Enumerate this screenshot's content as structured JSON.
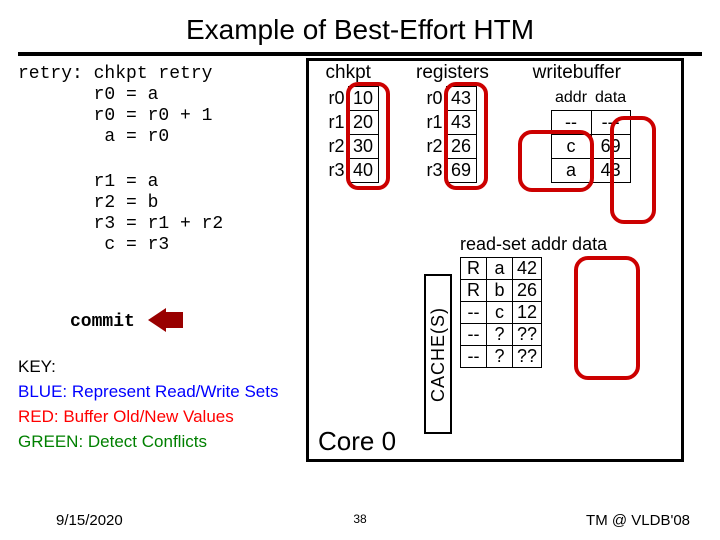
{
  "title": "Example of Best-Effort HTM",
  "code_block1": "retry: chkpt retry\n       r0 = a\n       r0 = r0 + 1\n        a = r0",
  "code_block2": "       r1 = a\n       r2 = b\n       r3 = r1 + r2\n        c = r3",
  "commit": "commit",
  "key": {
    "title": "KEY:",
    "blue": "BLUE: Represent Read/Write Sets",
    "red": "RED: Buffer Old/New Values",
    "green": "GREEN: Detect Conflicts"
  },
  "core_label": "Core 0",
  "cache_label": "CACHE(S)",
  "chkpt": {
    "header": "chkpt",
    "rows": [
      {
        "reg": "r0",
        "val": "10"
      },
      {
        "reg": "r1",
        "val": "20"
      },
      {
        "reg": "r2",
        "val": "30"
      },
      {
        "reg": "r3",
        "val": "40"
      }
    ]
  },
  "registers": {
    "header": "registers",
    "rows": [
      {
        "reg": "r0",
        "val": "43"
      },
      {
        "reg": "r1",
        "val": "43"
      },
      {
        "reg": "r2",
        "val": "26"
      },
      {
        "reg": "r3",
        "val": "69"
      }
    ]
  },
  "writebuffer": {
    "header": "writebuffer",
    "sub_addr": "addr",
    "sub_data": "data",
    "rows": [
      {
        "addr": "--",
        "data": "---"
      },
      {
        "addr": "c",
        "data": "69"
      },
      {
        "addr": "a",
        "data": "43"
      }
    ]
  },
  "readset": {
    "header": "read-set addr data",
    "rows": [
      {
        "flag": "R",
        "addr": "a",
        "data": "42"
      },
      {
        "flag": "R",
        "addr": "b",
        "data": "26"
      },
      {
        "flag": "--",
        "addr": "c",
        "data": "12"
      },
      {
        "flag": "--",
        "addr": "?",
        "data": "??"
      },
      {
        "flag": "--",
        "addr": "?",
        "data": "??"
      }
    ]
  },
  "footer": {
    "date": "9/15/2020",
    "page": "38",
    "conf": "TM @ VLDB'08"
  }
}
